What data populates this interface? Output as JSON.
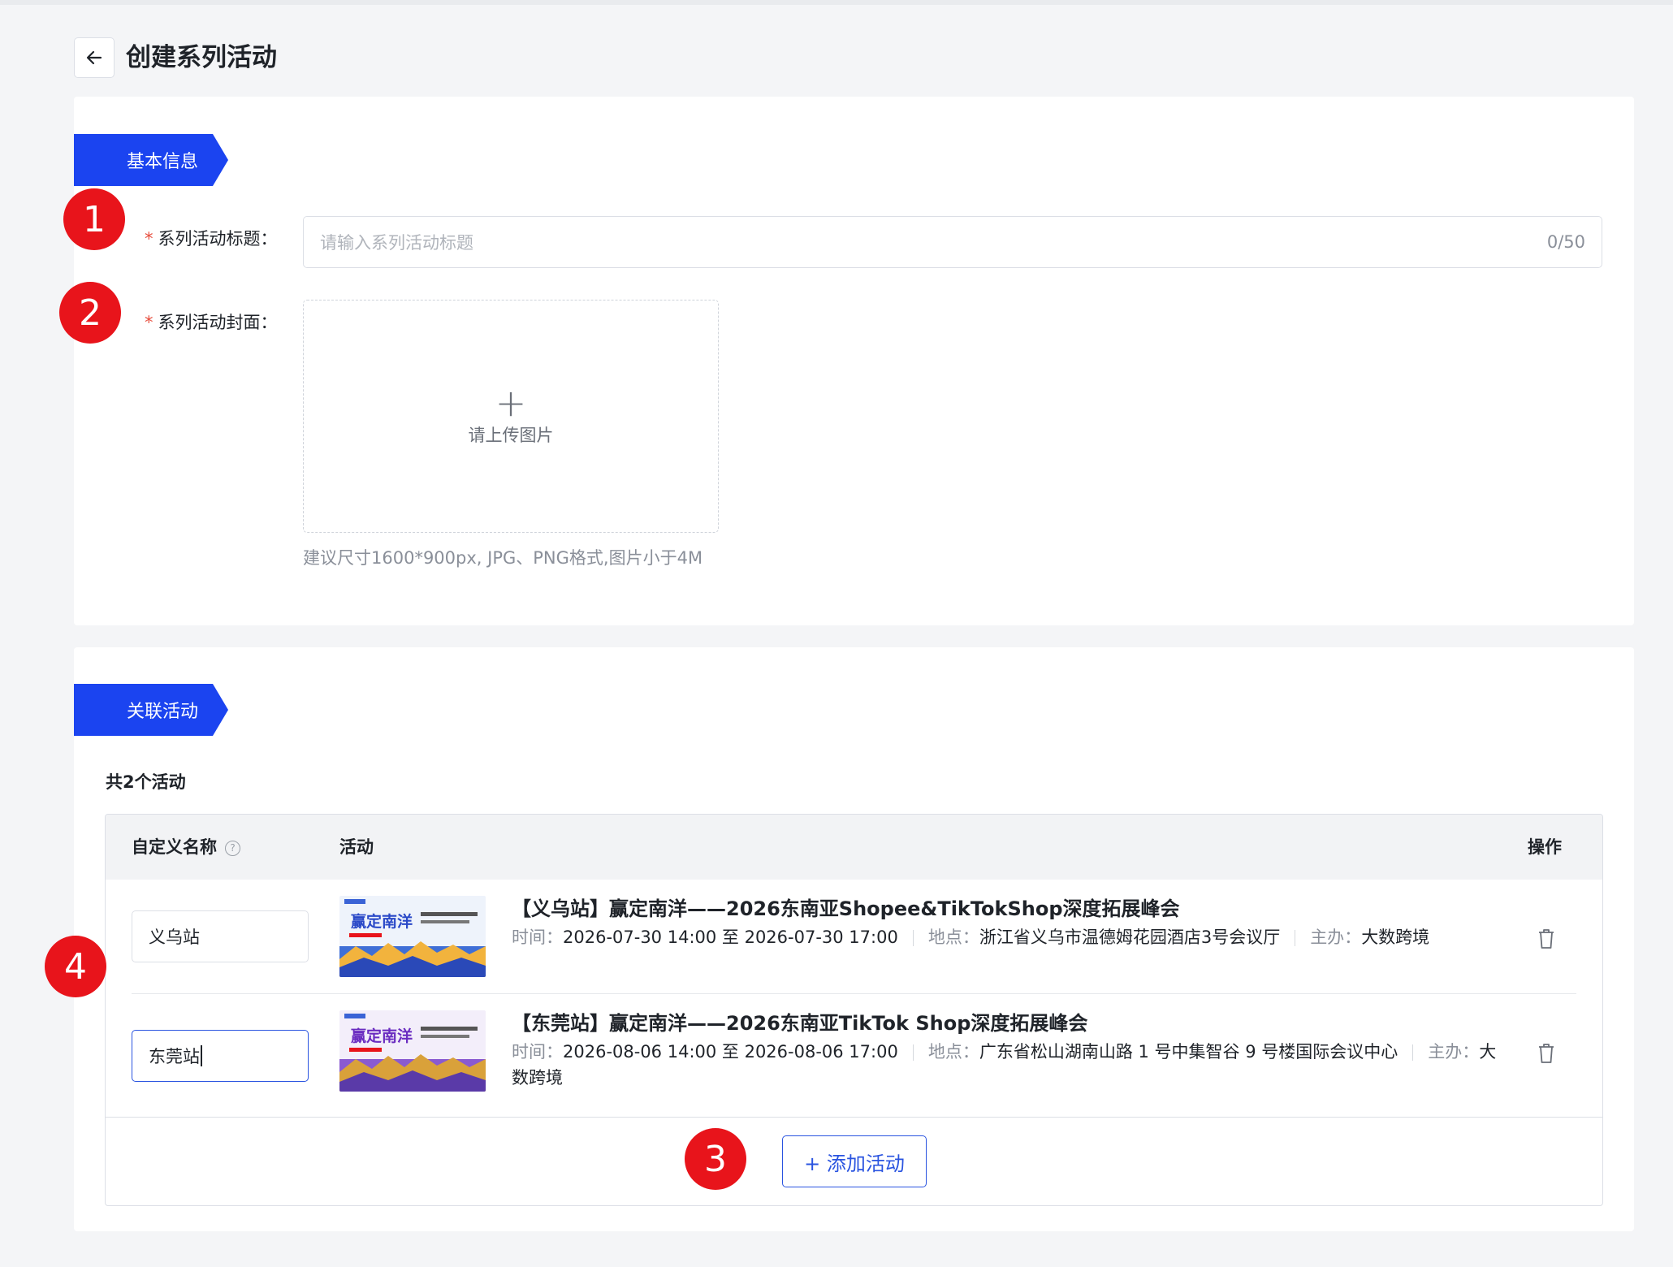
{
  "header": {
    "title": "创建系列活动"
  },
  "basic": {
    "section_label": "基本信息",
    "title_label": "系列活动标题：",
    "title_placeholder": "请输入系列活动标题",
    "title_counter": "0/50",
    "cover_label": "系列活动封面：",
    "upload_plus": "+",
    "upload_text": "请上传图片",
    "upload_hint": "建议尺寸1600*900px, JPG、PNG格式,图片小于4M"
  },
  "related": {
    "section_label": "关联活动",
    "count_text": "共2个活动",
    "columns": {
      "name": "自定义名称",
      "activity": "活动",
      "action": "操作"
    },
    "help_glyph": "?",
    "rows": [
      {
        "custom_name": "义乌站",
        "title": "【义乌站】赢定南洋——2026东南亚Shopee&TikTokShop深度拓展峰会",
        "time_key": "时间：",
        "time_value": "2026-07-30 14:00 至 2026-07-30 17:00",
        "place_key": "地点：",
        "place_value": "浙江省义乌市温德姆花园酒店3号会议厅",
        "host_key": "主办：",
        "host_value": "大数跨境",
        "thumb_text": "赢定南洋"
      },
      {
        "custom_name": "东莞站",
        "title": "【东莞站】赢定南洋——2026东南亚TikTok Shop深度拓展峰会",
        "time_key": "时间：",
        "time_value": "2026-08-06 14:00 至 2026-08-06 17:00",
        "place_key": "地点：",
        "place_value": "广东省松山湖南山路 1 号中集智谷 9 号楼国际会议中心",
        "host_key": "主办：",
        "host_value": "大数跨境",
        "thumb_text": "赢定南洋"
      }
    ],
    "add_button": "+ 添加活动"
  },
  "badges": [
    "1",
    "2",
    "3",
    "4"
  ],
  "colors": {
    "primary": "#1b44f0",
    "badge": "#e8141b",
    "required": "#e74c3c"
  }
}
